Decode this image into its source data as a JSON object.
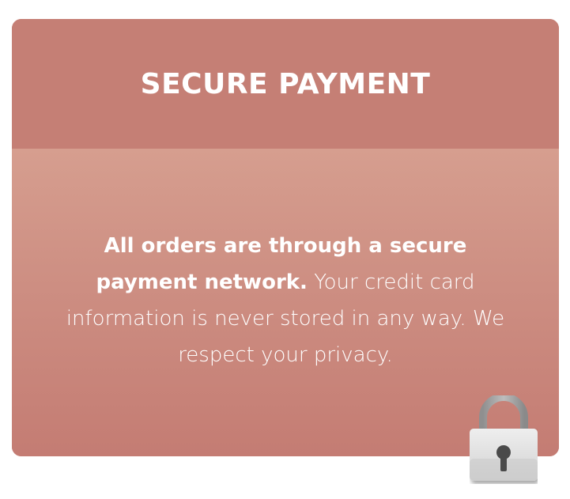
{
  "card": {
    "title": "SECURE PAYMENT",
    "message_bold": "All orders are through a secure payment network.",
    "message_rest": "Your credit card information is never stored in any way. We respect your privacy."
  },
  "icons": {
    "lock": "padlock-icon"
  },
  "colors": {
    "header": "#c57f75",
    "body_top": "#d69e8f",
    "body_bottom": "#c47c73",
    "text": "#ffffff"
  }
}
